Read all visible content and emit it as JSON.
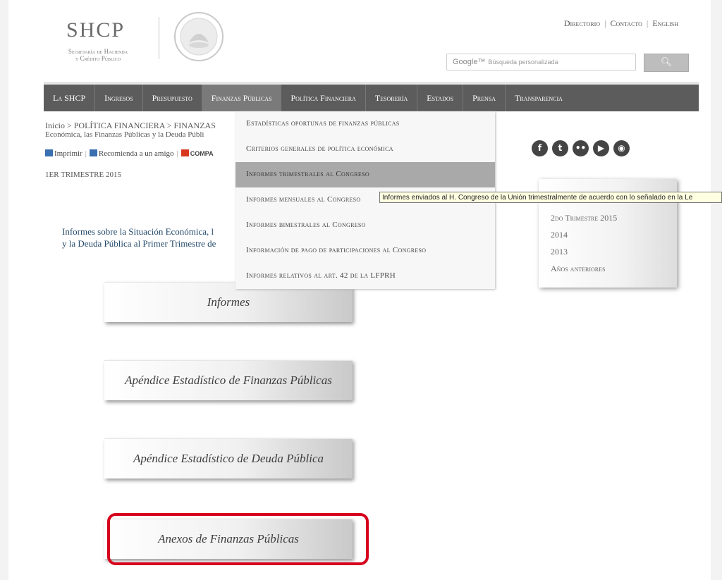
{
  "header": {
    "logo_title": "SHCP",
    "logo_sub_line1": "Secretaría de Hacienda",
    "logo_sub_line2": "y Crédito Público",
    "links": [
      "Directorio",
      "Contacto",
      "English"
    ],
    "search_brand": "Google™",
    "search_placeholder": "Búsqueda personalizada",
    "search_icon": "search-icon"
  },
  "nav": {
    "items": [
      "La SHCP",
      "Ingresos",
      "Presupuesto",
      "Finanzas Públicas",
      "Política Financiera",
      "Tesorería",
      "Estados",
      "Prensa",
      "Transparencia"
    ],
    "active": "Finanzas Públicas"
  },
  "breadcrumb": {
    "line1": "Inicio > POLÍTICA FINANCIERA > FINANZAS",
    "line2": "Económica, las Finanzas Públicas y la Deuda Públi"
  },
  "tools": {
    "print": "Imprimir",
    "recommend": "Recomienda a un amigo",
    "share": "COMPA"
  },
  "page_label": "1ER TRIMESTRE 2015",
  "intro": {
    "line1": "Informes sobre la Situación Económica, l",
    "line2": "y la Deuda Pública al Primer Trimestre de"
  },
  "dropdown": {
    "items": [
      "Estadísticas oportunas de finanzas públicas",
      "Criterios generales de política económica",
      "Informes trimestrales al Congreso",
      "Informes mensuales  al Congreso",
      "Informes bimestrales al Congreso",
      "Información de pago de participaciones al Congreso",
      "Informes relativos al  art. 42 de la LFPRH"
    ],
    "selected_index": 2
  },
  "tooltip": "Informes enviados al H. Congreso de la Unión trimestralmente de acuerdo con lo señalado en la Le",
  "social": [
    "facebook-icon",
    "twitter-icon",
    "flickr-icon",
    "youtube-icon",
    "webcam-icon"
  ],
  "sidebar": {
    "items": [
      "2do Trimestre 2015",
      "2014",
      "2013",
      "Años anteriores"
    ]
  },
  "buttons": [
    "Informes",
    "Apéndice Estadístico de Finanzas Públicas",
    "Apéndice Estadístico de Deuda Pública",
    "Anexos de Finanzas Públicas"
  ],
  "colors": {
    "nav_bg": "#5c5c5c",
    "highlight": "#d6001c",
    "dropdown_selected": "#a9a9a9"
  }
}
